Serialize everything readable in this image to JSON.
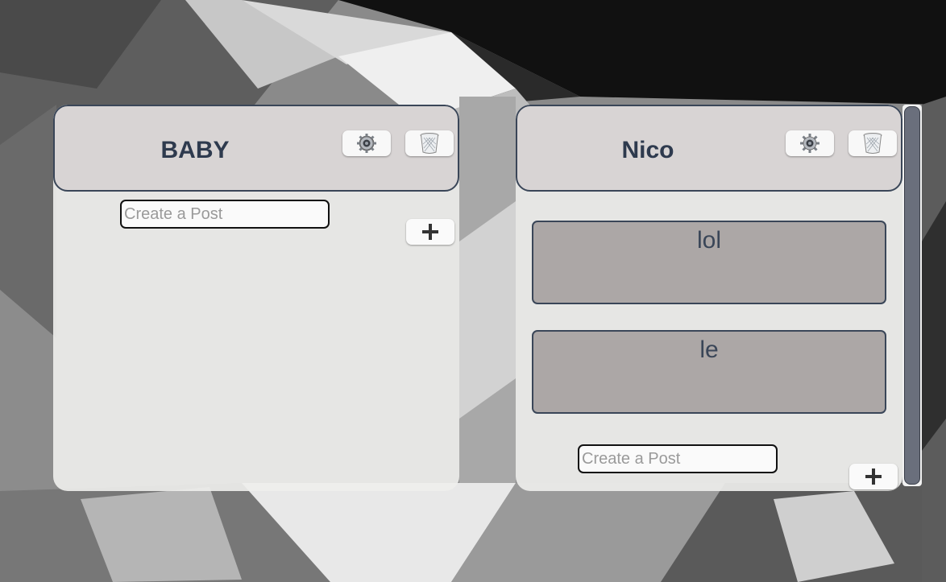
{
  "boards": [
    {
      "title": "BABY",
      "settings_icon": "gear-icon",
      "delete_icon": "trash-icon",
      "posts": [],
      "post_input": {
        "placeholder": "Create a Post",
        "value": ""
      },
      "add_icon": "plus-icon"
    },
    {
      "title": "Nico",
      "settings_icon": "gear-icon",
      "delete_icon": "trash-icon",
      "posts": [
        "lol",
        "le"
      ],
      "post_input": {
        "placeholder": "Create a Post",
        "value": ""
      },
      "add_icon": "plus-icon"
    }
  ],
  "colors": {
    "header_bg": "#d8d4d4",
    "border": "#3a4658",
    "title_text": "#2e3a4e",
    "post_bg": "#aca7a6",
    "board_bg": "#eeeeec"
  }
}
